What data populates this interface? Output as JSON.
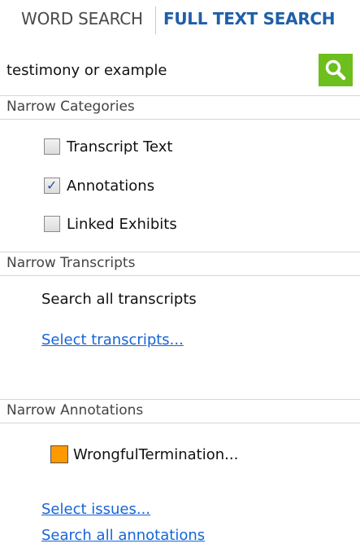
{
  "tabs": {
    "word_search": "WORD SEARCH",
    "full_text_search": "FULL TEXT SEARCH"
  },
  "search": {
    "value": "testimony or example",
    "button_icon": "magnifier-icon",
    "button_color": "#6cbf1c"
  },
  "categories": {
    "header": "Narrow Categories",
    "items": [
      {
        "label": "Transcript Text",
        "checked": false
      },
      {
        "label": "Annotations",
        "checked": true
      },
      {
        "label": "Linked Exhibits",
        "checked": false
      }
    ]
  },
  "transcripts": {
    "header": "Narrow Transcripts",
    "status": "Search all transcripts",
    "select_link": "Select transcripts..."
  },
  "annotations": {
    "header": "Narrow Annotations",
    "issue": {
      "label": "WrongfulTermination...",
      "color": "#ff9900"
    },
    "select_issues_link": "Select issues...",
    "search_all_link": "Search all annotations"
  }
}
